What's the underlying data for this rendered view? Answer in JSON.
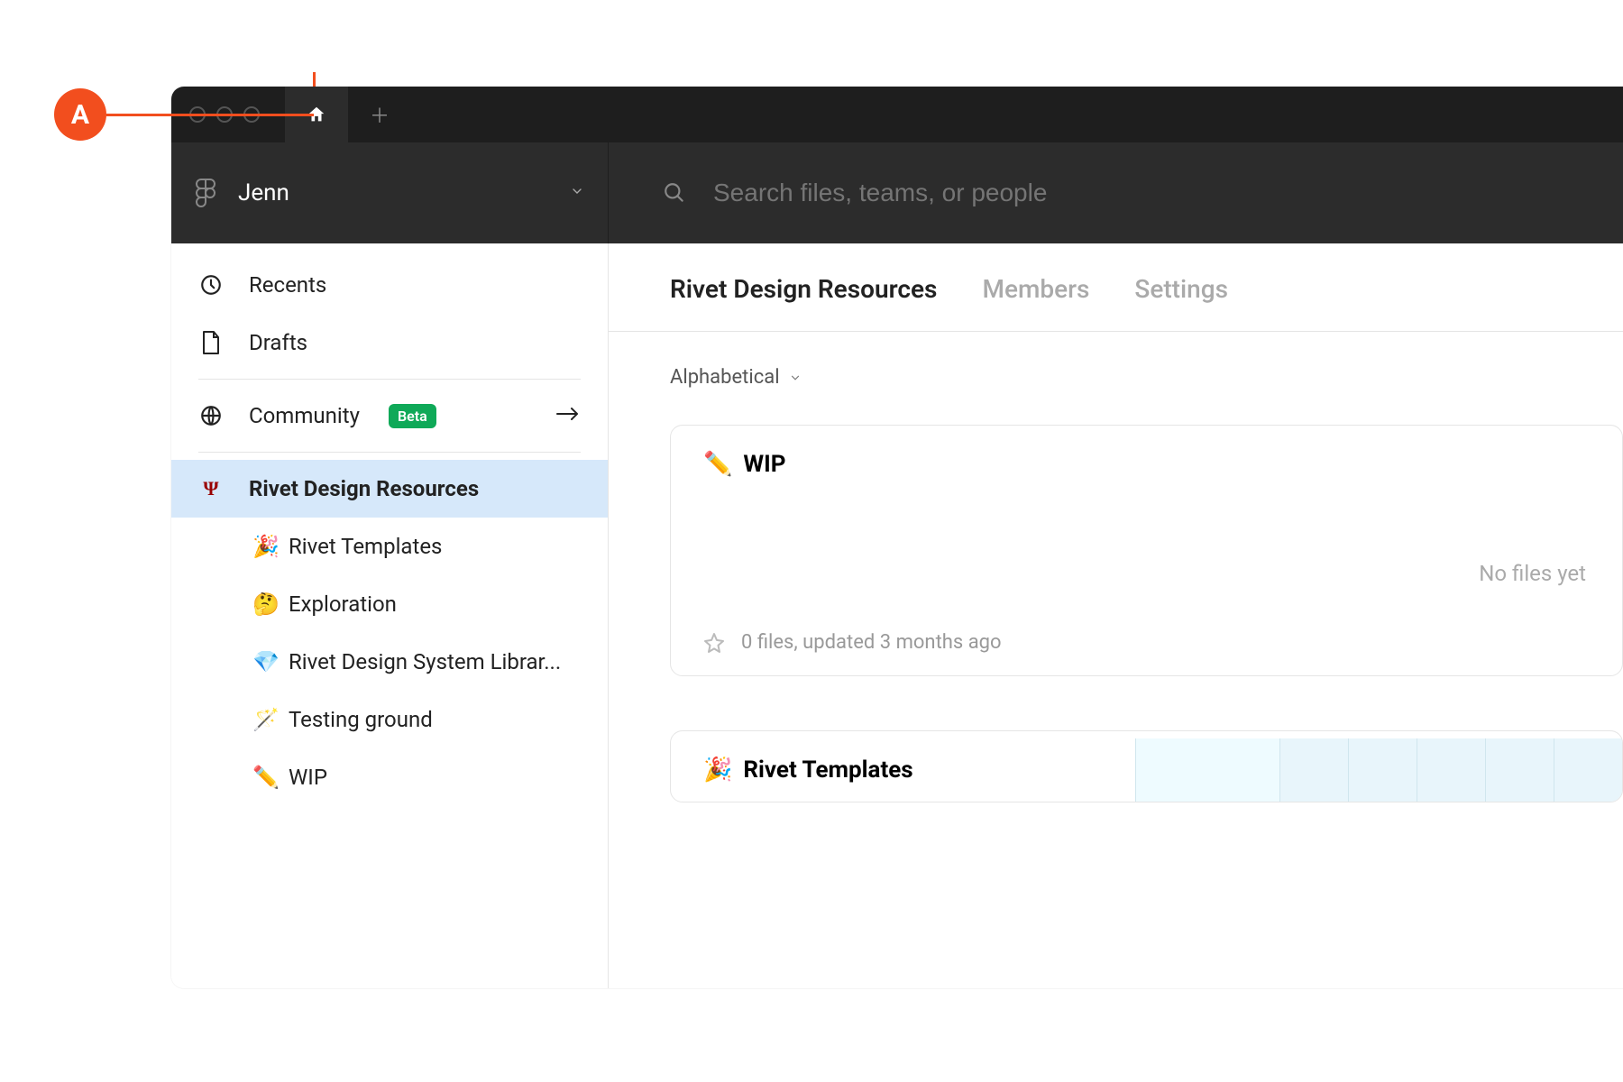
{
  "annotation": {
    "label": "A"
  },
  "header": {
    "username": "Jenn",
    "search_placeholder": "Search files, teams, or people"
  },
  "sidebar": {
    "recents": "Recents",
    "drafts": "Drafts",
    "community": "Community",
    "community_badge": "Beta",
    "team_name": "Rivet Design Resources",
    "projects": [
      {
        "emoji": "🎉",
        "label": "Rivet Templates"
      },
      {
        "emoji": "🤔",
        "label": "Exploration"
      },
      {
        "emoji": "💎",
        "label": "Rivet Design System Librar..."
      },
      {
        "emoji": "🪄",
        "label": "Testing ground"
      },
      {
        "emoji": "✏️",
        "label": "WIP"
      }
    ]
  },
  "main": {
    "tabs": {
      "resources": "Rivet Design Resources",
      "members": "Members",
      "settings": "Settings"
    },
    "sort_label": "Alphabetical",
    "cards": {
      "wip": {
        "emoji": "✏️",
        "title": "WIP",
        "empty_text": "No files yet",
        "footer": "0 files, updated 3 months ago"
      },
      "templates": {
        "emoji": "🎉",
        "title": "Rivet Templates"
      }
    }
  }
}
